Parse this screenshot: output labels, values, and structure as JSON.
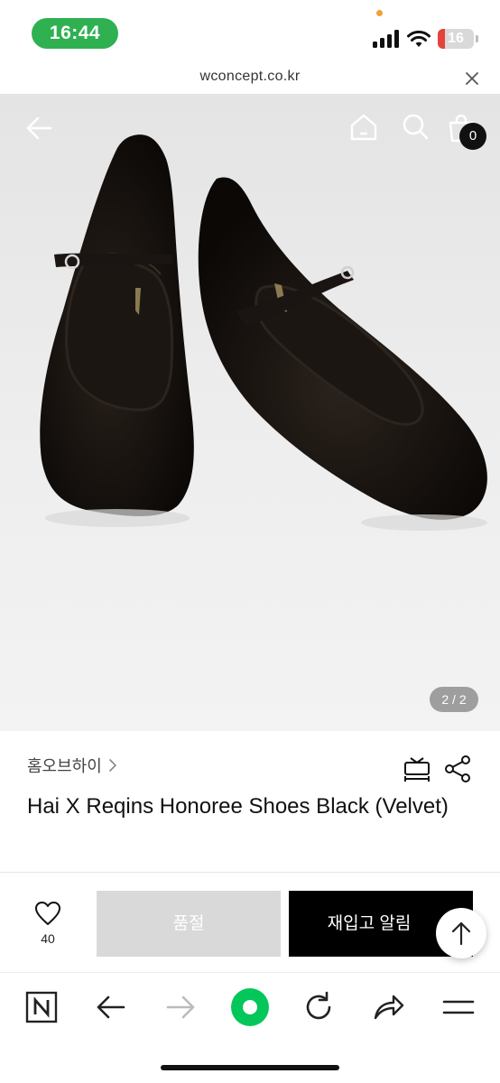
{
  "status_bar": {
    "time": "16:44",
    "battery": "16"
  },
  "url_bar": {
    "domain": "wconcept.co.kr"
  },
  "header": {
    "cart_count": "0"
  },
  "gallery": {
    "counter": "2 / 2"
  },
  "product": {
    "brand": "홈오브하이",
    "title": "Hai X Reqins Honoree Shoes Black (Velvet)"
  },
  "actions": {
    "like_count": "40",
    "sold_out_label": "품절",
    "restock_label": "재입고 알림"
  },
  "colors": {
    "status_green": "#2fb152",
    "sold_out_gray": "#d9d9d9",
    "primary_black": "#000000",
    "browser_accent": "#03c75a"
  },
  "icons": [
    "back-arrow-icon",
    "home-icon",
    "search-icon",
    "shopping-bag-icon",
    "size-guide-icon",
    "share-icon",
    "heart-icon",
    "arrow-up-icon",
    "naver-icon",
    "forward-icon",
    "refresh-icon",
    "menu-icon"
  ]
}
